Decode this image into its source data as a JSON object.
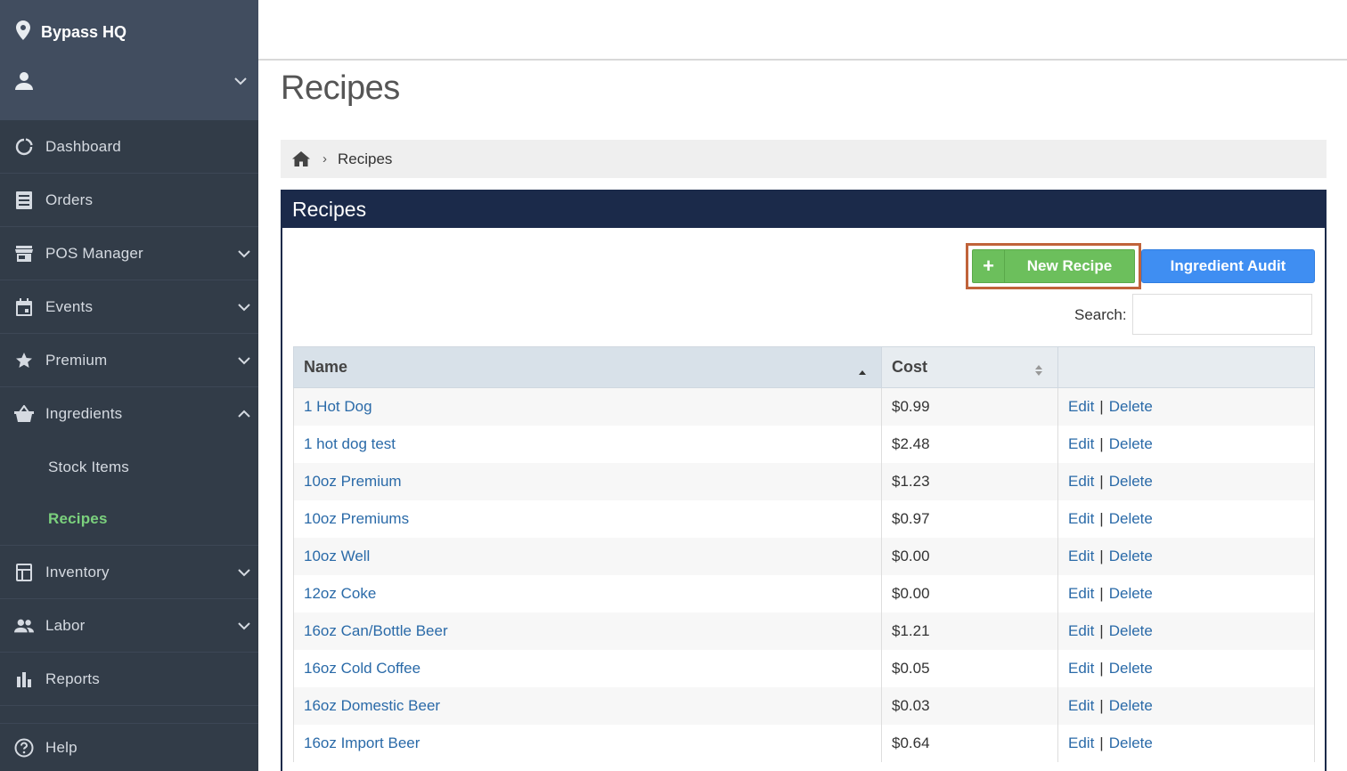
{
  "sidebar": {
    "location": "Bypass HQ",
    "items": [
      {
        "label": "Dashboard"
      },
      {
        "label": "Orders"
      },
      {
        "label": "POS Manager"
      },
      {
        "label": "Events"
      },
      {
        "label": "Premium"
      },
      {
        "label": "Ingredients"
      },
      {
        "label": "Inventory"
      },
      {
        "label": "Labor"
      },
      {
        "label": "Reports"
      }
    ],
    "subitems": [
      {
        "label": "Stock Items"
      },
      {
        "label": "Recipes"
      }
    ],
    "help": "Help"
  },
  "page": {
    "title": "Recipes",
    "breadcrumb_current": "Recipes",
    "panel_title": "Recipes"
  },
  "toolbar": {
    "new_recipe": "New Recipe",
    "new_recipe_icon": "+",
    "ingredient_audit": "Ingredient Audit",
    "search_label": "Search:",
    "search_value": ""
  },
  "table": {
    "headers": [
      "Name",
      "Cost",
      ""
    ],
    "sort_column": "Name",
    "rows": [
      {
        "name": "1 Hot Dog",
        "cost": "$0.99",
        "edit": "Edit",
        "sep": "|",
        "delete": "Delete"
      },
      {
        "name": "1 hot dog test",
        "cost": "$2.48",
        "edit": "Edit",
        "sep": "|",
        "delete": "Delete"
      },
      {
        "name": "10oz Premium",
        "cost": "$1.23",
        "edit": "Edit",
        "sep": "|",
        "delete": "Delete"
      },
      {
        "name": "10oz Premiums",
        "cost": "$0.97",
        "edit": "Edit",
        "sep": "|",
        "delete": "Delete"
      },
      {
        "name": "10oz Well",
        "cost": "$0.00",
        "edit": "Edit",
        "sep": "|",
        "delete": "Delete"
      },
      {
        "name": "12oz Coke",
        "cost": "$0.00",
        "edit": "Edit",
        "sep": "|",
        "delete": "Delete"
      },
      {
        "name": "16oz Can/Bottle Beer",
        "cost": "$1.21",
        "edit": "Edit",
        "sep": "|",
        "delete": "Delete"
      },
      {
        "name": "16oz Cold Coffee",
        "cost": "$0.05",
        "edit": "Edit",
        "sep": "|",
        "delete": "Delete"
      },
      {
        "name": "16oz Domestic Beer",
        "cost": "$0.03",
        "edit": "Edit",
        "sep": "|",
        "delete": "Delete"
      },
      {
        "name": "16oz Import Beer",
        "cost": "$0.64",
        "edit": "Edit",
        "sep": "|",
        "delete": "Delete"
      }
    ]
  },
  "colors": {
    "sidebar": "#323c48",
    "sidebar_top": "#414d5f",
    "active_green": "#7bd17d",
    "panel_header": "#1b2a4a",
    "new_button": "#6cbf5c",
    "audit_button": "#3f8ef2",
    "highlight_box": "#c0633a",
    "link": "#2a6aa8"
  }
}
